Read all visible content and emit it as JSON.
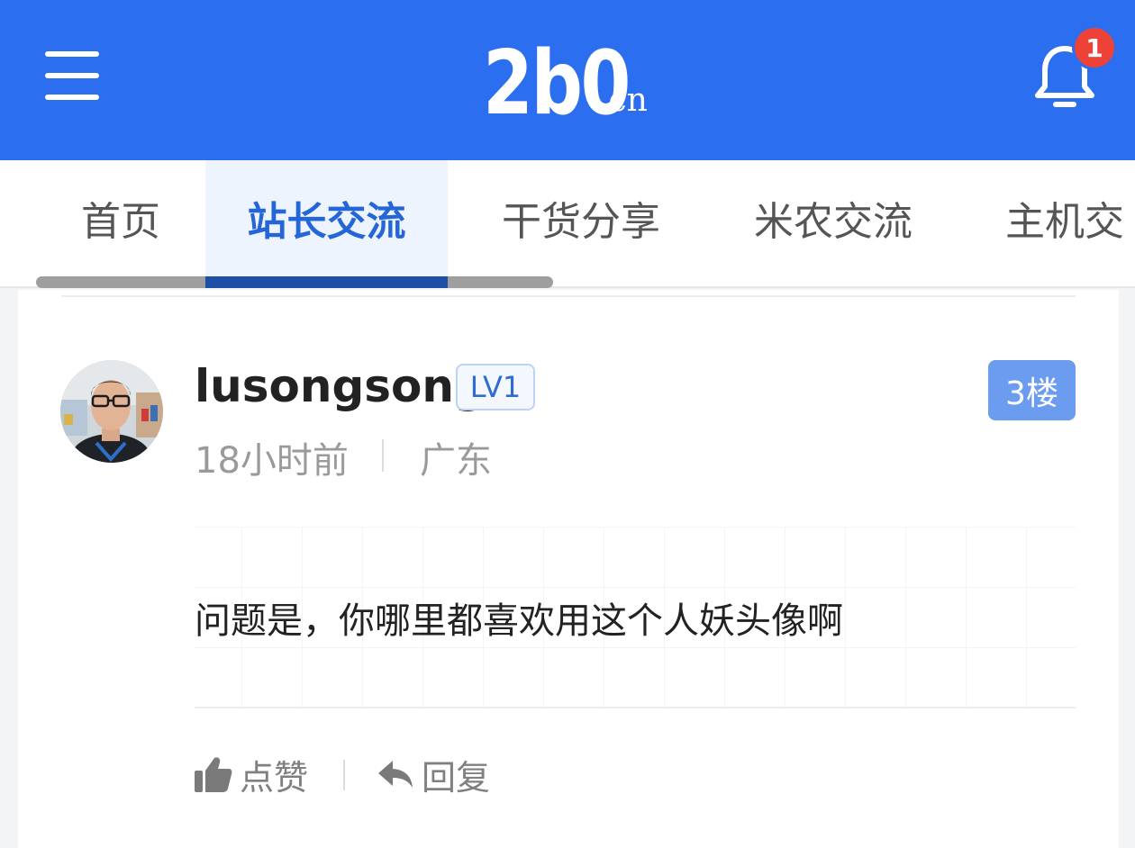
{
  "header": {
    "logo_main": "2b0",
    "logo_suffix": ".cn",
    "notification_count": "1",
    "brand_color": "#2b6ef0",
    "badge_color": "#ee4236",
    "icons": [
      "menu-icon",
      "bell-icon"
    ]
  },
  "tabs": [
    {
      "label": "首页",
      "active": false
    },
    {
      "label": "站长交流",
      "active": true
    },
    {
      "label": "干货分享",
      "active": false
    },
    {
      "label": "米农交流",
      "active": false
    },
    {
      "label": "主机交",
      "active": false
    }
  ],
  "post": {
    "username": "lusongsong",
    "level": "LV1",
    "floor": "3楼",
    "time": "18小时前",
    "location": "广东",
    "content": "问题是，你哪里都喜欢用这个人妖头像啊",
    "actions": {
      "like_label": "点赞",
      "reply_label": "回复"
    },
    "floor_color": "#6b9cf0",
    "level_color": "#2f6bd2"
  }
}
